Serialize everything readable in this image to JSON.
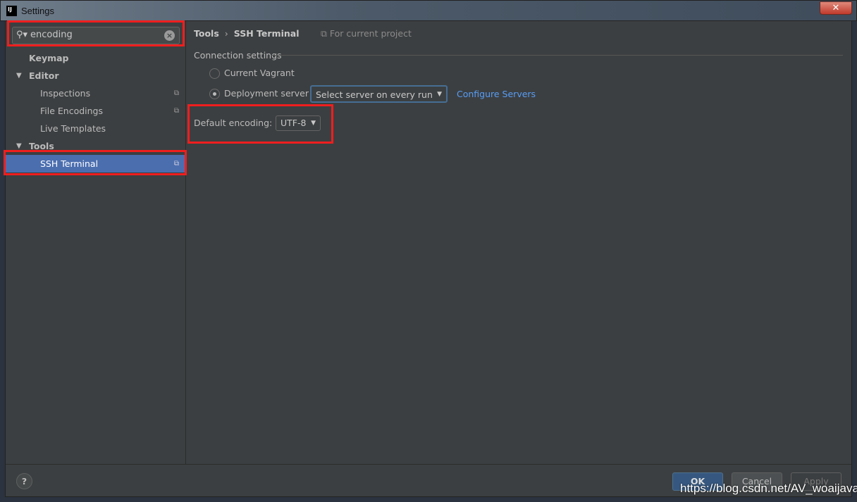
{
  "window": {
    "title": "Settings",
    "logo": "IJ",
    "close": "✕"
  },
  "sidebar": {
    "search": {
      "value": "encoding",
      "icon": "search-icon",
      "clear_icon": "clear-icon"
    },
    "items": [
      {
        "label": "Keymap",
        "bold": true
      },
      {
        "label": "Editor",
        "bold": true,
        "expanded": true
      },
      {
        "label": "Inspections",
        "copy_icon": true
      },
      {
        "label": "File Encodings",
        "copy_icon": true
      },
      {
        "label": "Live Templates"
      },
      {
        "label": "Tools",
        "bold": true,
        "expanded": true
      },
      {
        "label": "SSH Terminal",
        "copy_icon": true,
        "selected": true
      }
    ]
  },
  "main": {
    "breadcrumb": [
      "Tools",
      "SSH Terminal"
    ],
    "scope": "For current project",
    "connection_group": "Connection settings",
    "radio_vagrant": "Current Vagrant",
    "radio_deployment": "Deployment server",
    "selected_radio": "Deployment server",
    "server_select": "Select server on every run",
    "configure_link": "Configure Servers",
    "encoding_label": "Default encoding:",
    "encoding_value": "UTF-8"
  },
  "footer": {
    "help": "?",
    "ok": "OK",
    "cancel": "Cancel",
    "apply": "Apply"
  },
  "watermark": "https://blog.csdn.net/AV_woaijava",
  "colors": {
    "selection": "#4b6eaf",
    "link": "#589df6",
    "highlight": "#f01e1e"
  }
}
